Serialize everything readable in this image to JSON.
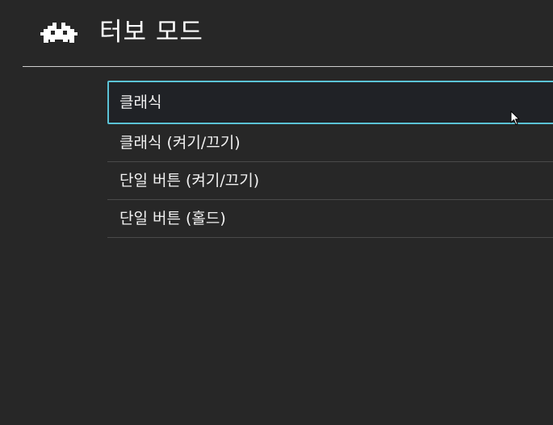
{
  "header": {
    "logo_icon": "retroarch-invader-icon",
    "title": "터보 모드"
  },
  "menu": {
    "selected_index": 0,
    "items": [
      {
        "label": "클래식"
      },
      {
        "label": "클래식 (켜기/끄기)"
      },
      {
        "label": "단일 버튼 (켜기/끄기)"
      },
      {
        "label": "단일 버튼 (홀드)"
      }
    ]
  },
  "colors": {
    "background": "#272727",
    "selection_border": "#5bc3d6",
    "selection_fill": "#202226",
    "text": "#f2f2f2"
  }
}
